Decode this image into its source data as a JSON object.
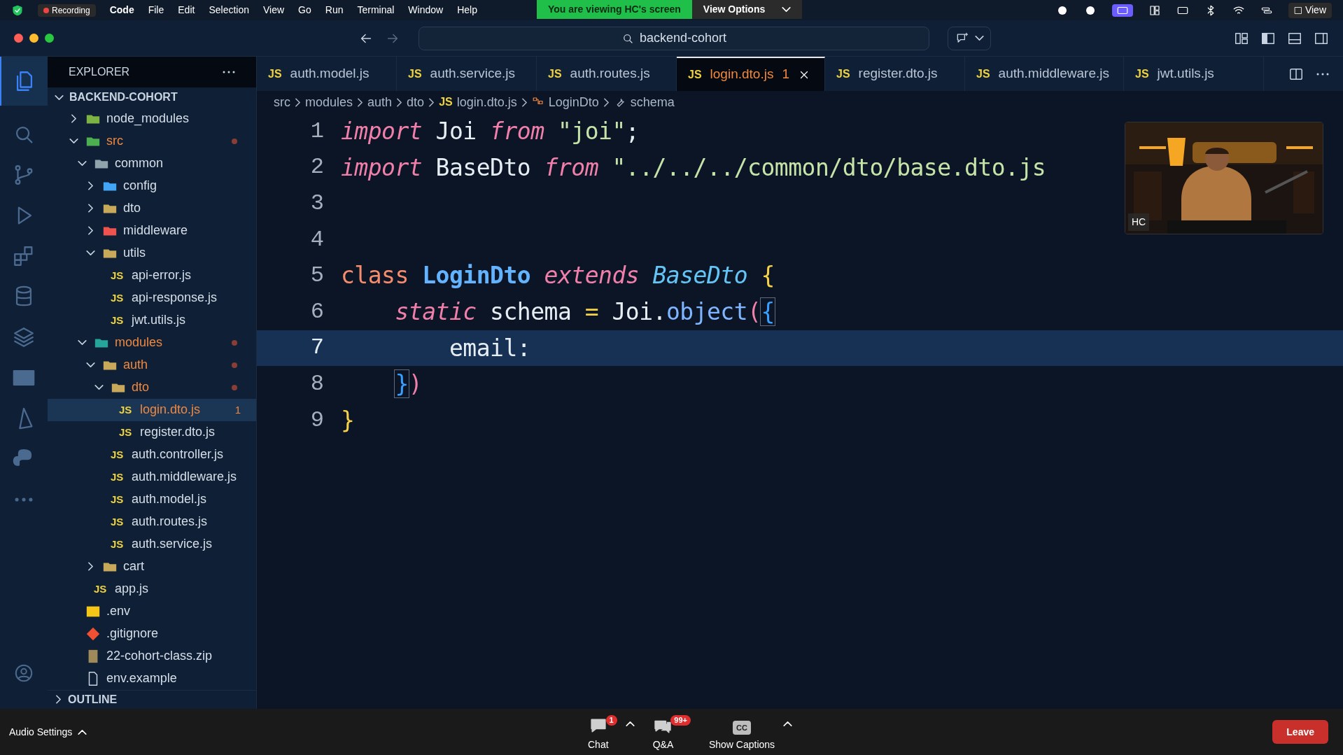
{
  "menu_bar": {
    "items": [
      "Code",
      "File",
      "Edit",
      "Selection",
      "View",
      "Go",
      "Run",
      "Terminal",
      "Window",
      "Help"
    ],
    "recording": "Recording",
    "banner": "You are viewing HC's screen",
    "view_options": "View Options",
    "view": "View"
  },
  "title_bar": {
    "search": "backend-cohort"
  },
  "explorer": {
    "title": "EXPLORER",
    "project": "BACKEND-COHORT",
    "outline": "OUTLINE",
    "tree": [
      {
        "name": "node_modules",
        "kind": "folder",
        "color": "#7cb342",
        "expanded": false,
        "modified": false
      },
      {
        "name": "src",
        "kind": "folder",
        "color": "#4caf50",
        "expanded": true,
        "modified": true,
        "children": [
          {
            "name": "common",
            "kind": "folder",
            "color": "#90a4ae",
            "expanded": true,
            "modified": false,
            "children": [
              {
                "name": "config",
                "kind": "folder",
                "color": "#42a5f5",
                "expanded": false,
                "modified": false
              },
              {
                "name": "dto",
                "kind": "folder",
                "color": "#c8a95a",
                "expanded": false,
                "modified": false
              },
              {
                "name": "middleware",
                "kind": "folder",
                "color": "#ef5350",
                "expanded": false,
                "modified": false
              },
              {
                "name": "utils",
                "kind": "folder",
                "color": "#c8a95a",
                "expanded": true,
                "modified": false,
                "children": [
                  {
                    "name": "api-error.js",
                    "kind": "js",
                    "icon": "JS",
                    "modified": false
                  },
                  {
                    "name": "api-response.js",
                    "kind": "js",
                    "icon": "JS",
                    "modified": false
                  },
                  {
                    "name": "jwt.utils.js",
                    "kind": "js",
                    "icon": "JS",
                    "modified": false
                  }
                ]
              }
            ]
          },
          {
            "name": "modules",
            "kind": "folder",
            "color": "#26a69a",
            "expanded": true,
            "modified": true,
            "children": [
              {
                "name": "auth",
                "kind": "folder",
                "color": "#c8a95a",
                "expanded": true,
                "modified": true,
                "children": [
                  {
                    "name": "dto",
                    "kind": "folder",
                    "color": "#c8a95a",
                    "expanded": true,
                    "modified": true,
                    "children": [
                      {
                        "name": "login.dto.js",
                        "kind": "js",
                        "icon": "JS",
                        "modified": true,
                        "badge": "1",
                        "selected": true
                      },
                      {
                        "name": "register.dto.js",
                        "kind": "js",
                        "icon": "JS",
                        "modified": false,
                        "selected": false
                      }
                    ]
                  },
                  {
                    "name": "auth.controller.js",
                    "kind": "js",
                    "icon": "JS",
                    "modified": false
                  },
                  {
                    "name": "auth.middleware.js",
                    "kind": "js",
                    "icon": "JS",
                    "modified": false
                  },
                  {
                    "name": "auth.model.js",
                    "kind": "js",
                    "icon": "JS",
                    "modified": false
                  },
                  {
                    "name": "auth.routes.js",
                    "kind": "js",
                    "icon": "JS",
                    "modified": false
                  },
                  {
                    "name": "auth.service.js",
                    "kind": "js",
                    "icon": "JS",
                    "modified": false
                  }
                ]
              },
              {
                "name": "cart",
                "kind": "folder",
                "color": "#c8a95a",
                "expanded": false,
                "modified": false
              }
            ]
          },
          {
            "name": "app.js",
            "kind": "js",
            "icon": "JS",
            "modified": false
          }
        ]
      },
      {
        "name": ".env",
        "kind": "env",
        "modified": false
      },
      {
        "name": ".gitignore",
        "kind": "git",
        "modified": false
      },
      {
        "name": "22-cohort-class.zip",
        "kind": "zip",
        "modified": false
      },
      {
        "name": "env.example",
        "kind": "file",
        "modified": false
      }
    ]
  },
  "tabs": [
    {
      "label": "auth.model.js",
      "icon": "JS",
      "selected": false
    },
    {
      "label": "auth.service.js",
      "icon": "JS",
      "selected": false
    },
    {
      "label": "auth.routes.js",
      "icon": "JS",
      "selected": false
    },
    {
      "label": "login.dto.js",
      "icon": "JS",
      "selected": true,
      "problems": "1"
    },
    {
      "label": "register.dto.js",
      "icon": "JS",
      "selected": false
    },
    {
      "label": "auth.middleware.js",
      "icon": "JS",
      "selected": false
    },
    {
      "label": "jwt.utils.js",
      "icon": "JS",
      "selected": false
    }
  ],
  "breadcrumb": [
    {
      "label": "src",
      "kind": "folder"
    },
    {
      "label": "modules",
      "kind": "folder"
    },
    {
      "label": "auth",
      "kind": "folder"
    },
    {
      "label": "dto",
      "kind": "folder"
    },
    {
      "label": "login.dto.js",
      "kind": "js",
      "icon": "JS"
    },
    {
      "label": "LoginDto",
      "kind": "class"
    },
    {
      "label": "schema",
      "kind": "property"
    }
  ],
  "editor": {
    "lines": [
      {
        "number": "1",
        "current": false,
        "tokens": [
          {
            "text": "import",
            "kind": "keyword"
          },
          {
            "text": " Joi ",
            "kind": "plain"
          },
          {
            "text": "from",
            "kind": "keyword"
          },
          {
            "text": " \"joi\"",
            "kind": "string"
          },
          {
            "text": ";",
            "kind": "plain"
          }
        ]
      },
      {
        "number": "2",
        "current": false,
        "tokens": [
          {
            "text": "import",
            "kind": "keyword"
          },
          {
            "text": " BaseDto ",
            "kind": "plain"
          },
          {
            "text": "from",
            "kind": "keyword"
          },
          {
            "text": " \"../../../common/dto/base.dto.js",
            "kind": "string"
          }
        ]
      },
      {
        "number": "3",
        "current": false
      },
      {
        "number": "4",
        "current": false
      },
      {
        "number": "5",
        "current": false,
        "tokens": [
          {
            "text": "class",
            "kind": "storage"
          },
          {
            "text": " LoginDto",
            "kind": "class"
          },
          {
            "text": " extends",
            "kind": "keyword"
          },
          {
            "text": " BaseDto",
            "kind": "type"
          },
          {
            "text": " {",
            "kind": "brace"
          }
        ]
      },
      {
        "number": "6",
        "current": false,
        "tokens": [
          {
            "text": "    static",
            "kind": "keyword"
          },
          {
            "text": " schema ",
            "kind": "plain"
          },
          {
            "text": "=",
            "kind": "brace"
          },
          {
            "text": " Joi.",
            "kind": "plain"
          },
          {
            "text": "object",
            "kind": "function"
          },
          {
            "text": "(",
            "kind": "paren"
          },
          {
            "text": "{",
            "kind": "bracket"
          }
        ]
      },
      {
        "number": "7",
        "current": true,
        "tokens": [
          {
            "text": "        email:",
            "kind": "plain"
          }
        ]
      },
      {
        "number": "8",
        "current": false,
        "tokens": [
          {
            "text": "    }",
            "kind": "bracket"
          },
          {
            "text": ")",
            "kind": "paren"
          }
        ]
      },
      {
        "number": "9",
        "current": false,
        "tokens": [
          {
            "text": "}",
            "kind": "brace"
          }
        ]
      }
    ]
  },
  "video": {
    "kind": "picture",
    "label": "HC"
  },
  "meeting_bar": {
    "audio": "Audio Settings",
    "chat": {
      "label": "Chat",
      "badge": "1"
    },
    "qa": {
      "label": "Q&A",
      "badge": "99+"
    },
    "captions": {
      "label": "Show Captions",
      "icon": "CC"
    },
    "leave": "Leave"
  }
}
